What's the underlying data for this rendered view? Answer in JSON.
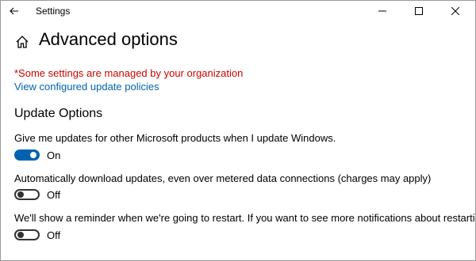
{
  "window": {
    "title": "Settings",
    "icons": {
      "back": "back-arrow-icon",
      "minimize": "minimize-icon",
      "maximize": "maximize-icon",
      "close": "close-icon"
    }
  },
  "header": {
    "home_icon": "home-icon",
    "page_title": "Advanced options"
  },
  "notice": {
    "managed_text": "*Some settings are managed by your organization",
    "policy_link": "View configured update policies",
    "managed_color": "#c50500",
    "link_color": "#0063b1"
  },
  "update_options": {
    "section_title": "Update Options",
    "settings": [
      {
        "label": "Give me updates for other Microsoft products when I update Windows.",
        "state": "On",
        "enabled": true
      },
      {
        "label": "Automatically download updates, even over metered data connections (charges may apply)",
        "state": "Off",
        "enabled": false
      },
      {
        "label": "We'll show a reminder when we're going to restart. If you want to see more notifications about restarting, turn this on.",
        "state": "Off",
        "enabled": false
      }
    ]
  },
  "accent_color": "#0063b1"
}
